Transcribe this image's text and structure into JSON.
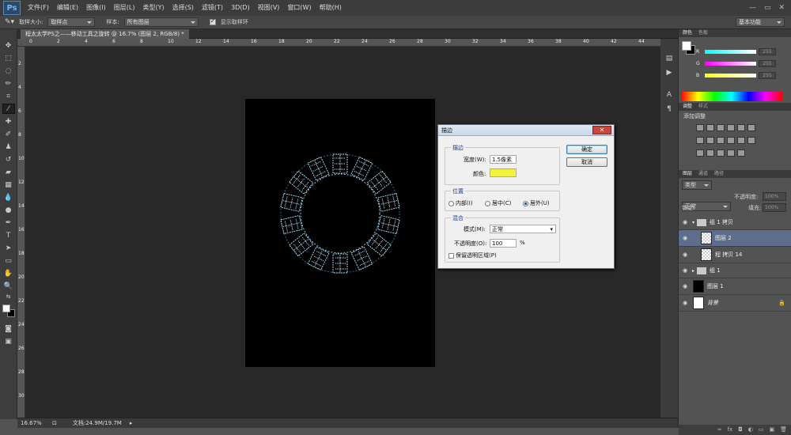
{
  "menubar": {
    "logo": "Ps",
    "items": [
      "文件(F)",
      "编辑(E)",
      "图像(I)",
      "图层(L)",
      "类型(Y)",
      "选择(S)",
      "滤镜(T)",
      "3D(D)",
      "视图(V)",
      "窗口(W)",
      "帮助(H)"
    ],
    "window_controls": [
      "—",
      "▭",
      "✕"
    ]
  },
  "options_bar": {
    "sample_size_label": "取样大小:",
    "sample_size_value": "取样点",
    "sample_label": "样本:",
    "sample_value": "所有图层",
    "show_ring_label": "显示取样环",
    "workspace": "基本功能"
  },
  "document": {
    "tab_title": "程太太学PS之——移动工具之旋转 @ 16.7% (图层 2, RGB/8) *",
    "ruler_top": [
      "0",
      "2",
      "4",
      "6",
      "8",
      "10",
      "12",
      "14",
      "16",
      "18",
      "20",
      "22",
      "24",
      "26",
      "28",
      "30",
      "32",
      "34",
      "36",
      "38",
      "40",
      "42",
      "44"
    ],
    "ruler_left": [
      "2",
      "4",
      "6",
      "8",
      "10",
      "12",
      "14",
      "16",
      "18",
      "20",
      "22",
      "24",
      "26",
      "28",
      "30"
    ]
  },
  "statusbar": {
    "zoom": "16.67%",
    "doc_info": "文档:24.9M/19.7M"
  },
  "color_panel": {
    "tabs": [
      "颜色",
      "色板"
    ],
    "r_label": "R",
    "r_value": "255",
    "g_label": "G",
    "g_value": "255",
    "b_label": "B",
    "b_value": "255"
  },
  "adjust_panel": {
    "tabs": [
      "调整",
      "样式"
    ],
    "add_label": "添加调整"
  },
  "layers_panel": {
    "tabs": [
      "图层",
      "通道",
      "路径"
    ],
    "kind_label": "类型",
    "blend_mode": "正常",
    "opacity_label": "不透明度:",
    "opacity_value": "100%",
    "lock_label": "锁定:",
    "fill_label": "填充:",
    "fill_value": "100%",
    "layers": [
      {
        "name": "组 1 拷贝"
      },
      {
        "name": "图层 2"
      },
      {
        "name": "程 拷贝 14"
      },
      {
        "name": "组 1"
      },
      {
        "name": "图层 1"
      },
      {
        "name": "背景"
      }
    ]
  },
  "dialog": {
    "title": "描边",
    "stroke_group": "描边",
    "width_label": "宽度(W):",
    "width_value": "1.5像素",
    "color_label": "颜色:",
    "stroke_color": "#f0f23c",
    "position_group": "位置",
    "inside_label": "内部(I)",
    "center_label": "居中(C)",
    "outside_label": "居外(U)",
    "blend_group": "混合",
    "mode_label": "模式(M):",
    "mode_value": "正常",
    "opacity_label": "不透明度(O):",
    "opacity_value": "100",
    "percent": "%",
    "preserve_label": "保留透明区域(P)",
    "ok_label": "确定",
    "cancel_label": "取消"
  }
}
